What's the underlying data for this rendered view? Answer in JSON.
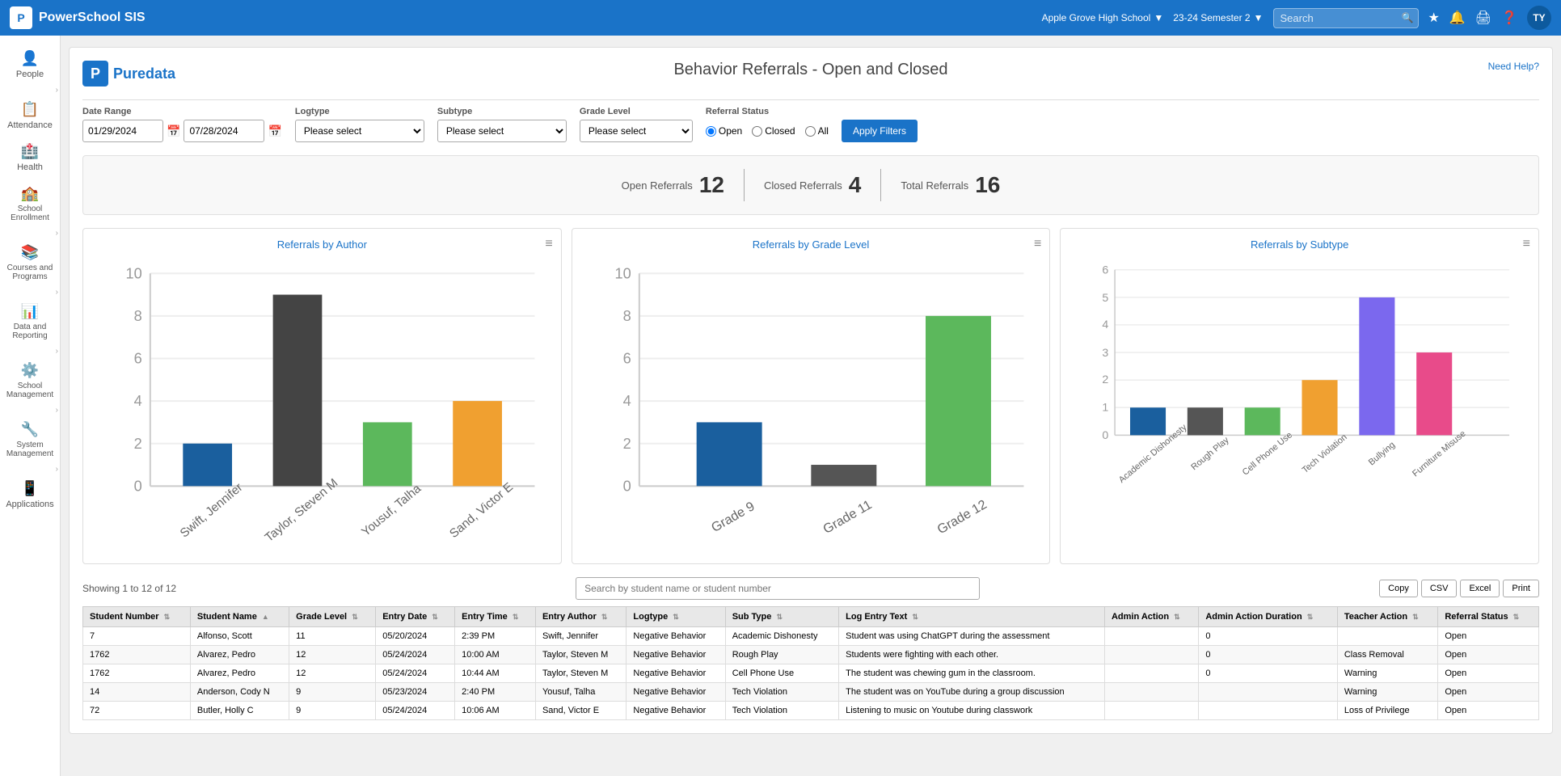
{
  "app": {
    "title": "PowerSchool SIS",
    "logo_text": "P"
  },
  "topnav": {
    "search_placeholder": "Search",
    "school": "Apple Grove High School",
    "semester": "23-24 Semester 2",
    "avatar": "TY"
  },
  "sidebar": {
    "items": [
      {
        "id": "people",
        "label": "People",
        "icon": "👤"
      },
      {
        "id": "attendance",
        "label": "Attendance",
        "icon": "📋"
      },
      {
        "id": "health",
        "label": "Health",
        "icon": "🏥"
      },
      {
        "id": "school-enrollment",
        "label": "School Enrollment",
        "icon": "🏫"
      },
      {
        "id": "courses-programs",
        "label": "Courses and Programs",
        "icon": "📚"
      },
      {
        "id": "data-reporting",
        "label": "Data and Reporting",
        "icon": "📊"
      },
      {
        "id": "school-management",
        "label": "School Management",
        "icon": "⚙️"
      },
      {
        "id": "system-management",
        "label": "System Management",
        "icon": "🔧"
      },
      {
        "id": "applications",
        "label": "Applications",
        "icon": "📱"
      }
    ]
  },
  "page": {
    "logo": "Puredata",
    "title": "Behavior Referrals - Open and Closed",
    "need_help": "Need Help?",
    "filters": {
      "date_range_label": "Date Range",
      "date_start": "01/29/2024",
      "date_end": "07/28/2024",
      "logtype_label": "Logtype",
      "logtype_default": "Please select",
      "subtype_label": "Subtype",
      "subtype_default": "Please select",
      "grade_level_label": "Grade Level",
      "grade_level_default": "Please select",
      "referral_status_label": "Referral Status",
      "radio_open": "Open",
      "radio_closed": "Closed",
      "radio_all": "All",
      "apply_btn": "Apply Filters"
    },
    "stats": {
      "open_label": "Open Referrals",
      "open_value": "12",
      "closed_label": "Closed Referrals",
      "closed_value": "4",
      "total_label": "Total Referrals",
      "total_value": "16"
    },
    "charts": {
      "author_title": "Referrals by Author",
      "grade_title": "Referrals by Grade Level",
      "subtype_title": "Referrals by Subtype"
    },
    "table": {
      "showing": "Showing 1 to 12 of 12",
      "search_placeholder": "Search by student name or student number",
      "copy_btn": "Copy",
      "csv_btn": "CSV",
      "excel_btn": "Excel",
      "print_btn": "Print",
      "columns": [
        "Student Number",
        "Student Name",
        "Grade Level",
        "Entry Date",
        "Entry Time",
        "Entry Author",
        "Logtype",
        "Sub Type",
        "Log Entry Text",
        "Admin Action",
        "Admin Action Duration",
        "Teacher Action",
        "Referral Status"
      ],
      "rows": [
        {
          "student_number": "7",
          "student_name": "Alfonso, Scott",
          "grade_level": "11",
          "entry_date": "05/20/2024",
          "entry_time": "2:39 PM",
          "entry_author": "Swift, Jennifer",
          "logtype": "Negative Behavior",
          "sub_type": "Academic Dishonesty",
          "log_entry_text": "Student was using ChatGPT during the assessment",
          "admin_action": "",
          "admin_action_duration": "0",
          "teacher_action": "",
          "referral_status": "Open"
        },
        {
          "student_number": "1762",
          "student_name": "Alvarez, Pedro",
          "grade_level": "12",
          "entry_date": "05/24/2024",
          "entry_time": "10:00 AM",
          "entry_author": "Taylor, Steven M",
          "logtype": "Negative Behavior",
          "sub_type": "Rough Play",
          "log_entry_text": "Students were fighting with each other.",
          "admin_action": "",
          "admin_action_duration": "0",
          "teacher_action": "Class Removal",
          "referral_status": "Open"
        },
        {
          "student_number": "1762",
          "student_name": "Alvarez, Pedro",
          "grade_level": "12",
          "entry_date": "05/24/2024",
          "entry_time": "10:44 AM",
          "entry_author": "Taylor, Steven M",
          "logtype": "Negative Behavior",
          "sub_type": "Cell Phone Use",
          "log_entry_text": "The student was chewing gum in the classroom.",
          "admin_action": "",
          "admin_action_duration": "0",
          "teacher_action": "Warning",
          "referral_status": "Open"
        },
        {
          "student_number": "14",
          "student_name": "Anderson, Cody N",
          "grade_level": "9",
          "entry_date": "05/23/2024",
          "entry_time": "2:40 PM",
          "entry_author": "Yousuf, Talha",
          "logtype": "Negative Behavior",
          "sub_type": "Tech Violation",
          "log_entry_text": "The student was on YouTube during a group discussion",
          "admin_action": "",
          "admin_action_duration": "",
          "teacher_action": "Warning",
          "referral_status": "Open"
        },
        {
          "student_number": "72",
          "student_name": "Butler, Holly C",
          "grade_level": "9",
          "entry_date": "05/24/2024",
          "entry_time": "10:06 AM",
          "entry_author": "Sand, Victor E",
          "logtype": "Negative Behavior",
          "sub_type": "Tech Violation",
          "log_entry_text": "Listening to music on Youtube during classwork",
          "admin_action": "",
          "admin_action_duration": "",
          "teacher_action": "Loss of Privilege",
          "referral_status": "Open"
        }
      ]
    }
  },
  "charts_data": {
    "author": {
      "bars": [
        {
          "label": "Swift, Jennifer",
          "value": 2,
          "color": "#1a5f9e"
        },
        {
          "label": "Taylor, Steven M",
          "value": 9,
          "color": "#444444"
        },
        {
          "label": "Yousuf, Talha",
          "value": 3,
          "color": "#5cb85c"
        },
        {
          "label": "Sand, Victor E",
          "value": 4,
          "color": "#f0a030"
        }
      ],
      "max": 10,
      "y_labels": [
        "10",
        "8",
        "6",
        "4",
        "2",
        "0"
      ]
    },
    "grade": {
      "bars": [
        {
          "label": "Grade 9",
          "value": 3,
          "color": "#1a5f9e"
        },
        {
          "label": "Grade 11",
          "value": 1,
          "color": "#555555"
        },
        {
          "label": "Grade 12",
          "value": 8,
          "color": "#5cb85c"
        }
      ],
      "max": 10,
      "y_labels": [
        "10",
        "8",
        "6",
        "4",
        "2",
        "0"
      ]
    },
    "subtype": {
      "bars": [
        {
          "label": "Academic Dishonesty",
          "value": 1,
          "color": "#1a5f9e"
        },
        {
          "label": "Rough Play",
          "value": 1,
          "color": "#555555"
        },
        {
          "label": "Cell Phone Use",
          "value": 1,
          "color": "#5cb85c"
        },
        {
          "label": "Tech Violation",
          "value": 2,
          "color": "#f0a030"
        },
        {
          "label": "Bullying",
          "value": 5,
          "color": "#7b68ee"
        },
        {
          "label": "Furniture Misuse",
          "value": 3,
          "color": "#e84b8a"
        }
      ],
      "max": 6,
      "y_labels": [
        "6",
        "5",
        "4",
        "3",
        "2",
        "1",
        "0"
      ]
    }
  }
}
